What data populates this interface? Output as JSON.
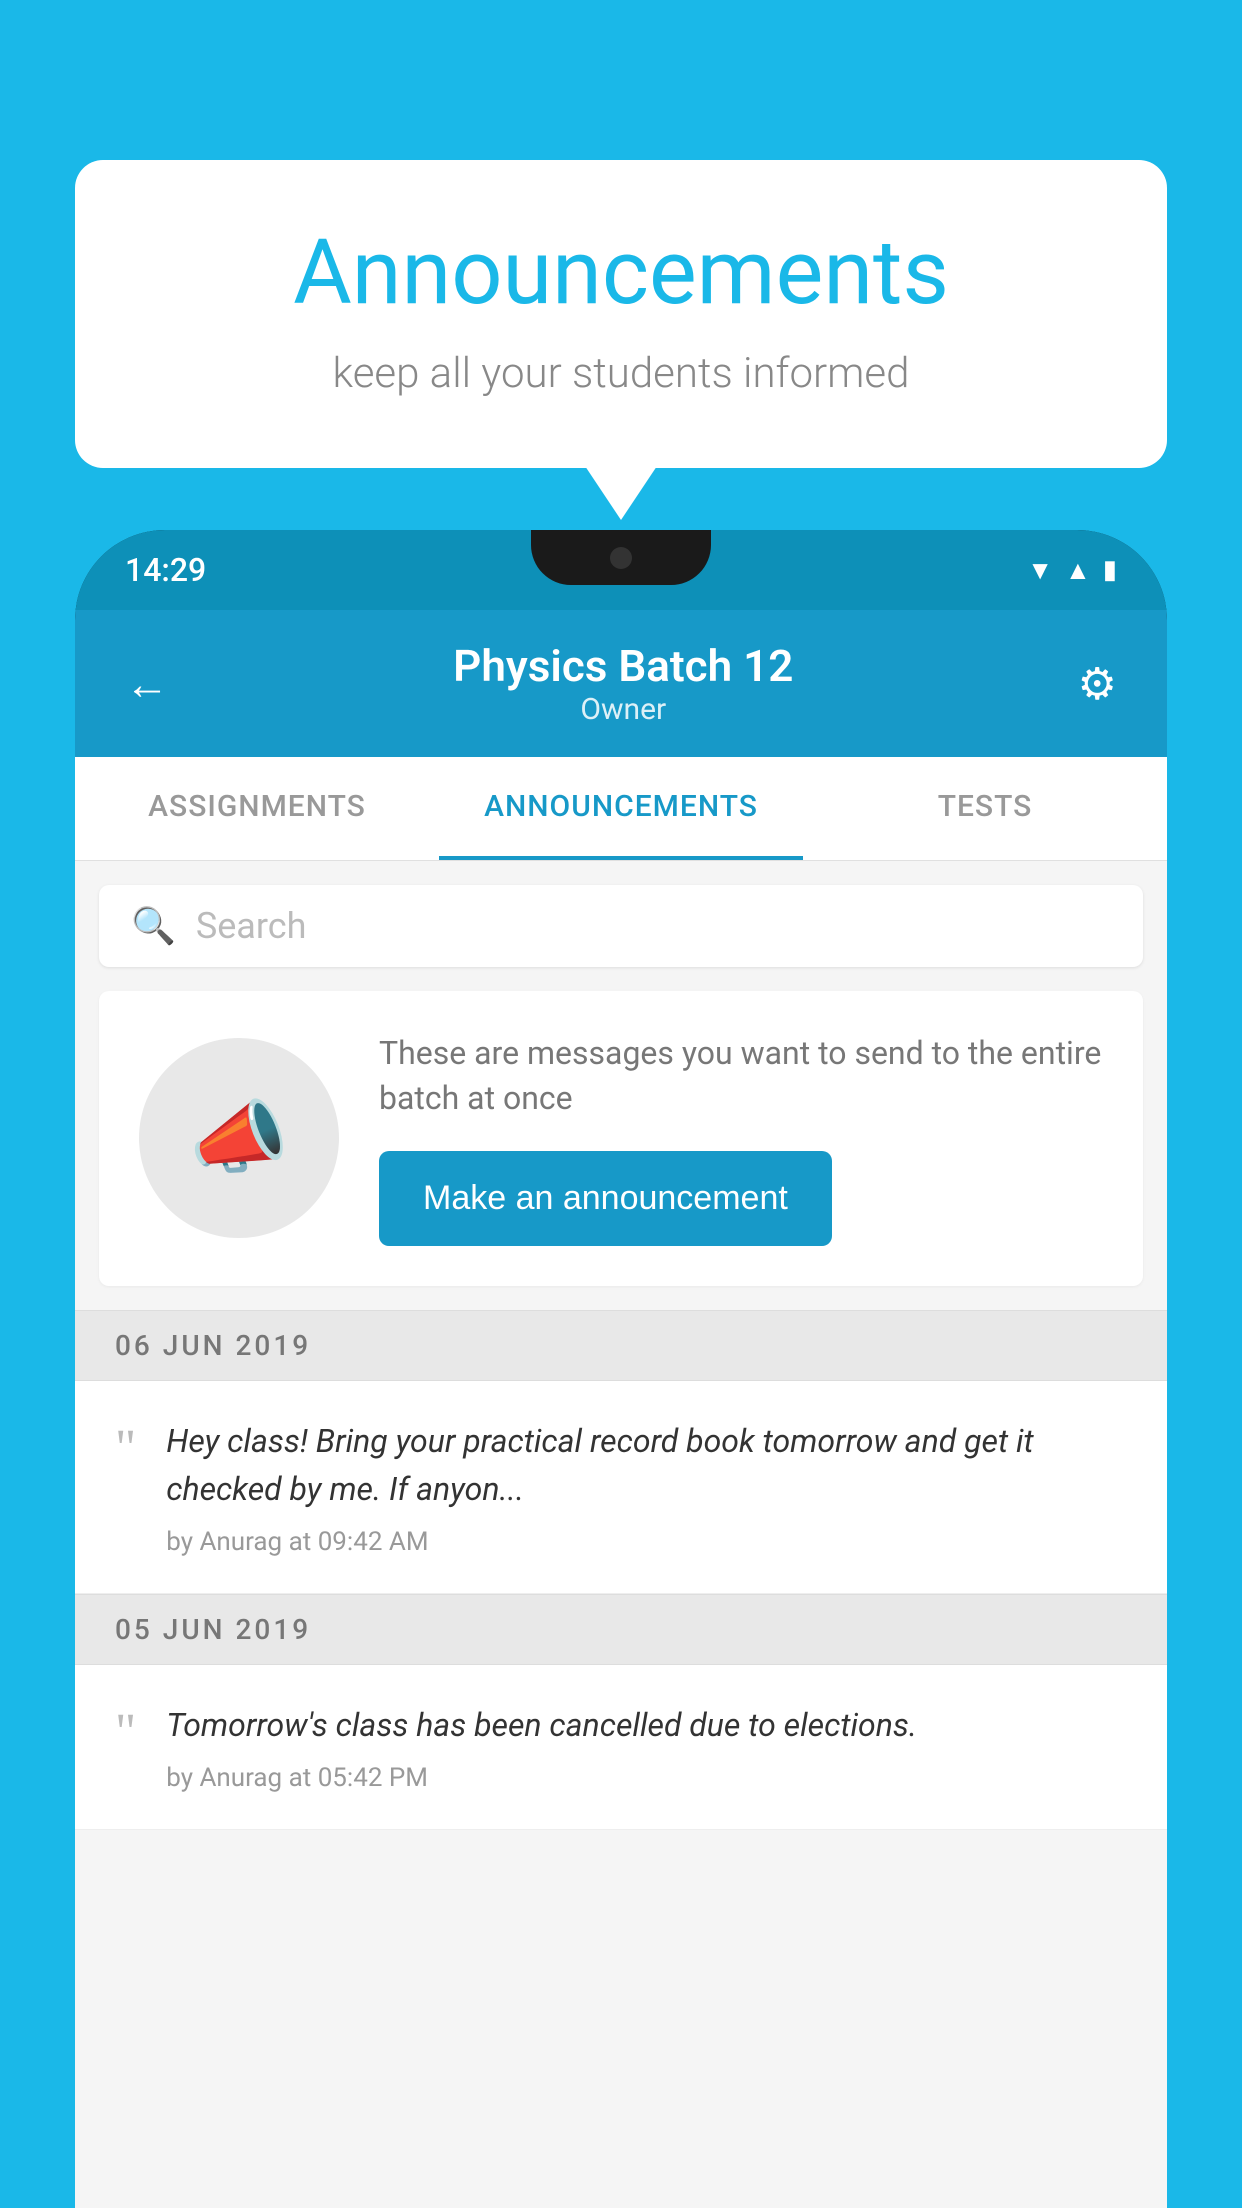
{
  "background_color": "#1ab8e8",
  "bubble": {
    "title": "Announcements",
    "subtitle": "keep all your students informed"
  },
  "phone": {
    "status_bar": {
      "time": "14:29",
      "icons": [
        "▼",
        "▲",
        "▮"
      ]
    },
    "app_bar": {
      "title": "Physics Batch 12",
      "subtitle": "Owner",
      "back_label": "←",
      "gear_label": "⚙"
    },
    "tabs": [
      {
        "label": "ASSIGNMENTS",
        "active": false
      },
      {
        "label": "ANNOUNCEMENTS",
        "active": true
      },
      {
        "label": "TESTS",
        "active": false
      }
    ],
    "search": {
      "placeholder": "Search"
    },
    "prompt": {
      "text": "These are messages you want to send to the entire batch at once",
      "button_label": "Make an announcement"
    },
    "announcements": [
      {
        "date": "06  JUN  2019",
        "message": "Hey class! Bring your practical record book tomorrow and get it checked by me. If anyon...",
        "meta": "by Anurag at 09:42 AM"
      },
      {
        "date": "05  JUN  2019",
        "message": "Tomorrow's class has been cancelled due to elections.",
        "meta": "by Anurag at 05:42 PM"
      }
    ]
  }
}
